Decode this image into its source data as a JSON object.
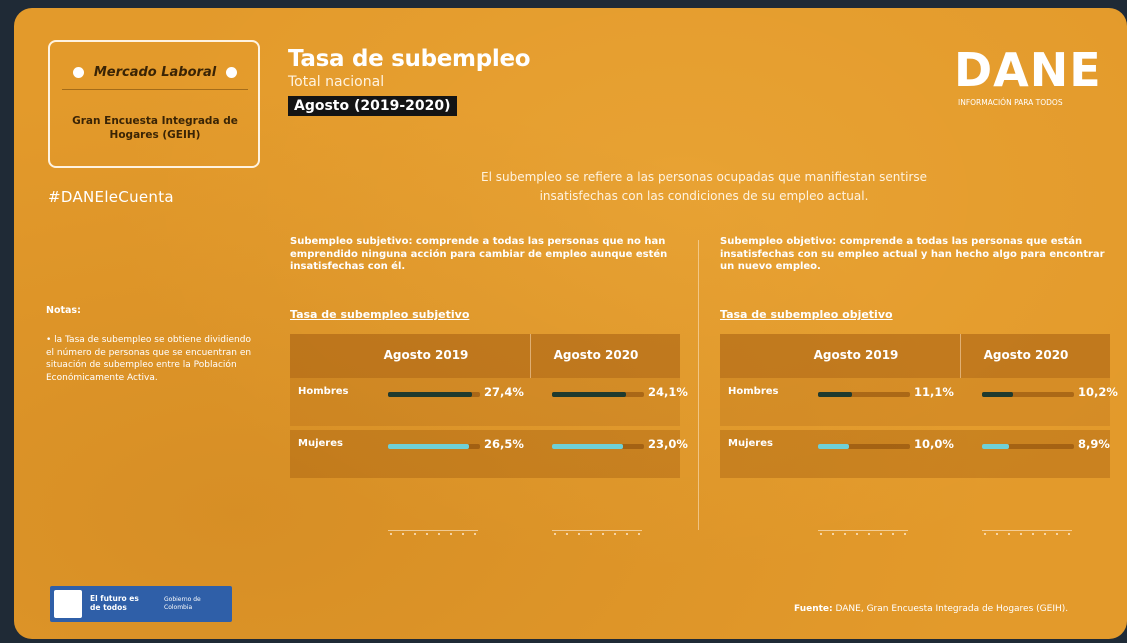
{
  "header": {
    "badge_label": "Mercado Laboral",
    "survey_name": "Gran Encuesta Integrada de Hogares (GEIH)",
    "hashtag": "#DANEleCuenta",
    "title": "Tasa de subempleo",
    "subtitle": "Total nacional",
    "period": "Agosto (2019-2020)",
    "logo": "DANE",
    "logo_tagline": "INFORMACIÓN PARA TODOS"
  },
  "intro": "El subempleo se refiere a las personas ocupadas que manifiestan sentirse insatisfechas con las condiciones de su empleo actual.",
  "definitions": {
    "subjective": "Subempleo subjetivo: comprende a todas las personas que no han emprendido ninguna acción para cambiar de empleo aunque estén insatisfechas con él.",
    "objective": "Subempleo objetivo: comprende a todas las personas que están insatisfechas con su empleo actual y han hecho algo para encontrar un nuevo empleo."
  },
  "notes": {
    "title": "Notas:",
    "body": "• la Tasa de subempleo se obtiene dividiendo el número de personas que se encuentran en situación de subempleo entre la Población Económicamente Activa."
  },
  "source": {
    "label": "Fuente:",
    "text": "DANE, Gran Encuesta Integrada de Hogares (GEIH)."
  },
  "gov": {
    "line1": "El futuro es de todos",
    "line2": "Gobierno de Colombia"
  },
  "colors": {
    "background": "#e39a2b",
    "hombres": "#1f3a2e",
    "mujeres": "#6fd0d6"
  },
  "chart_data": [
    {
      "type": "bar",
      "title": "Tasa de subempleo subjetivo",
      "categories": [
        "Hombres",
        "Mujeres"
      ],
      "columns": [
        "Agosto 2019",
        "Agosto 2020"
      ],
      "series": [
        {
          "name": "Agosto 2019",
          "values": [
            27.4,
            26.5
          ],
          "labels": [
            "27,4%",
            "26,5%"
          ]
        },
        {
          "name": "Agosto 2020",
          "values": [
            24.1,
            23.0
          ],
          "labels": [
            "24,1%",
            "23,0%"
          ]
        }
      ],
      "ylim": [
        0,
        30
      ]
    },
    {
      "type": "bar",
      "title": "Tasa de subempleo objetivo",
      "categories": [
        "Hombres",
        "Mujeres"
      ],
      "columns": [
        "Agosto 2019",
        "Agosto 2020"
      ],
      "series": [
        {
          "name": "Agosto 2019",
          "values": [
            11.1,
            10.0
          ],
          "labels": [
            "11,1%",
            "10,0%"
          ]
        },
        {
          "name": "Agosto 2020",
          "values": [
            10.2,
            8.9
          ],
          "labels": [
            "10,2%",
            "8,9%"
          ]
        }
      ],
      "ylim": [
        0,
        30
      ]
    }
  ]
}
